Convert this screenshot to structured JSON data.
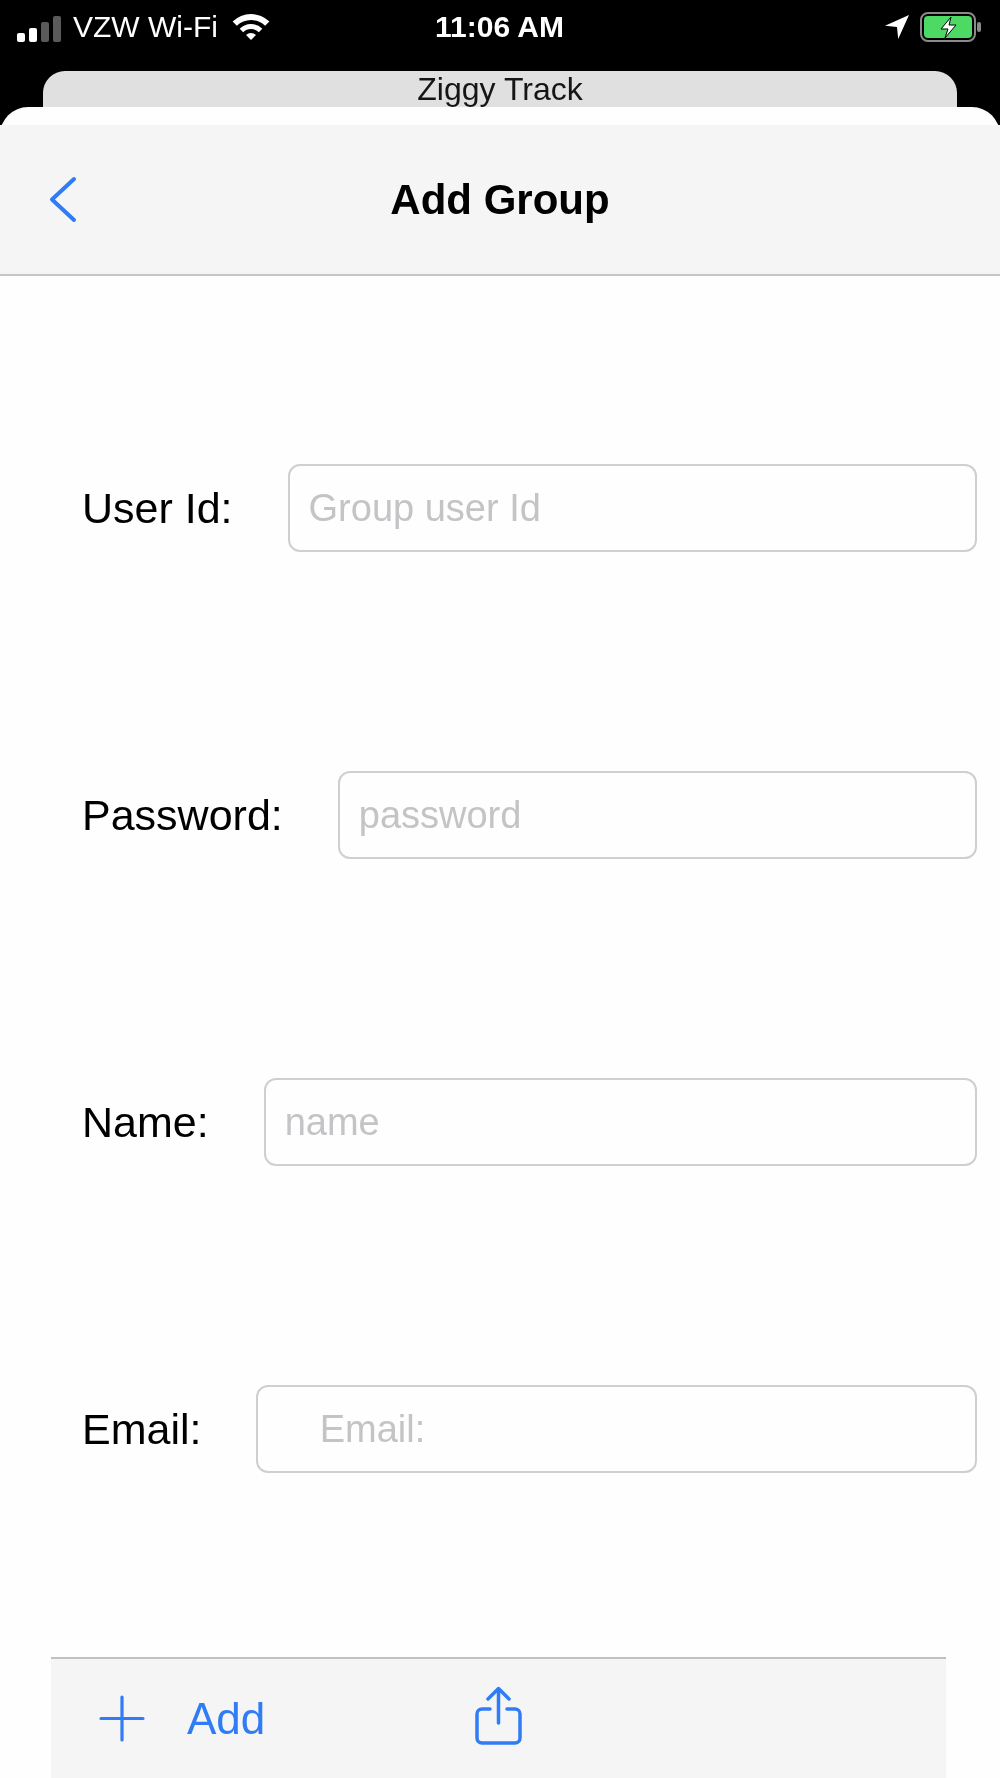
{
  "status_bar": {
    "carrier": "VZW Wi-Fi",
    "time": "11:06 AM"
  },
  "background_screen": {
    "title": "Ziggy Track"
  },
  "nav_bar": {
    "title": "Add Group"
  },
  "form": {
    "fields": [
      {
        "label": "User Id:",
        "placeholder": "Group user Id"
      },
      {
        "label": "Password:",
        "placeholder": "password"
      },
      {
        "label": "Name:",
        "placeholder": "name"
      },
      {
        "label": "Email:",
        "placeholder": "    Email:"
      }
    ]
  },
  "toolbar": {
    "items": [
      {
        "kind": "add",
        "label": "Add"
      },
      {
        "kind": "share"
      }
    ]
  }
}
